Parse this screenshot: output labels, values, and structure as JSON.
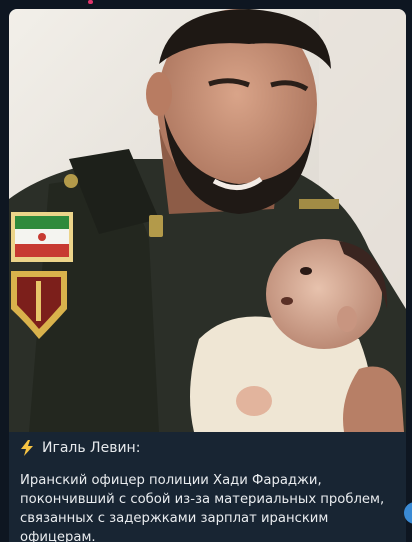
{
  "post": {
    "author": "Игаль Левин:",
    "text": "Иранский офицер полиции Хади Фараджи, покончивший с собой из-за материальных проблем, связанных с задержками зарплат иранским офицерам.",
    "bolt_icon": "high-voltage-icon",
    "photo_alt": "photo"
  },
  "theme": {
    "background": "#0e1621",
    "bubble": "#182533",
    "accent": "#3a8ad4",
    "bolt": "#f6c343"
  }
}
